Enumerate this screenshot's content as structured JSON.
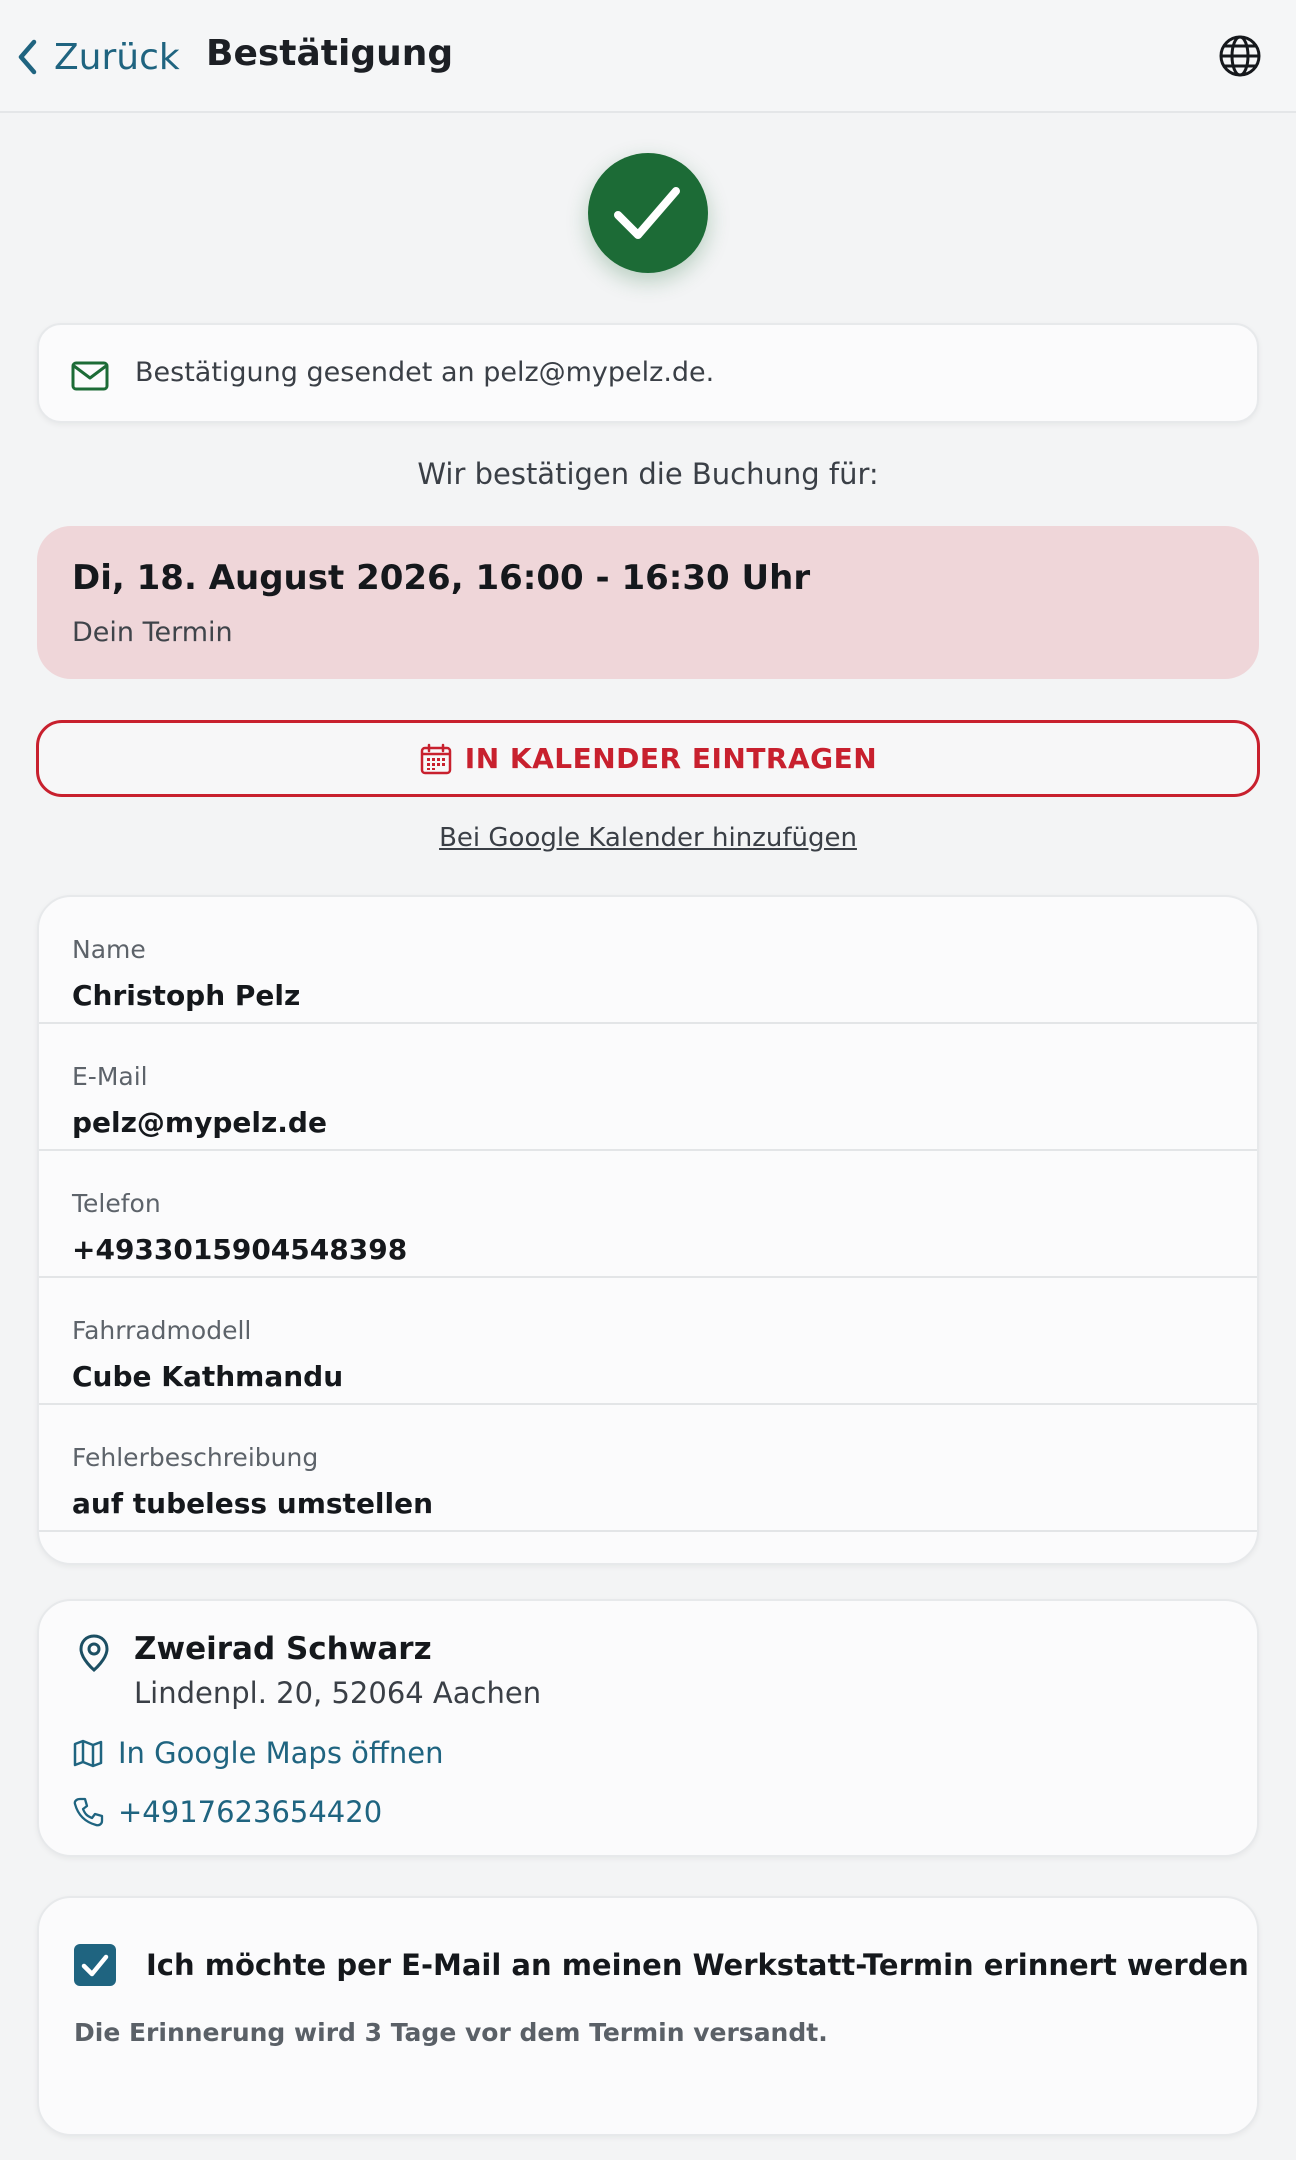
{
  "header": {
    "back_label": "Zurück",
    "title": "Bestätigung",
    "language_icon": "globe-icon"
  },
  "status": {
    "icon": "checkmark-icon",
    "color": "#1c6b36"
  },
  "email_notice": {
    "icon": "mail-icon",
    "text": "Bestätigung gesendet an pelz@mypelz.de."
  },
  "confirm_intro": "Wir bestätigen die Buchung für:",
  "appointment": {
    "time": "Di, 18. August 2026, 16:00 - 16:30 Uhr",
    "subtitle": "Dein Termin",
    "background": "#efd6d9"
  },
  "calendar_button": {
    "icon": "calendar-icon",
    "label": "IN KALENDER EINTRAGEN",
    "accent": "#c8202e"
  },
  "google_calendar_link": "Bei Google Kalender hinzufügen",
  "details": [
    {
      "label": "Name",
      "value": "Christoph Pelz"
    },
    {
      "label": "E-Mail",
      "value": "pelz@mypelz.de"
    },
    {
      "label": "Telefon",
      "value": "+4933015904548398"
    },
    {
      "label": "Fahrradmodell",
      "value": "Cube Kathmandu"
    },
    {
      "label": "Fehlerbeschreibung",
      "value": "auf tubeless umstellen"
    }
  ],
  "location": {
    "name": "Zweirad Schwarz",
    "address": "Lindenpl. 20, 52064 Aachen",
    "maps_link": "In Google Maps öffnen",
    "phone": "+4917623654420",
    "link_color": "#1f6480"
  },
  "reminder": {
    "checked": true,
    "label": "Ich möchte per E-Mail an meinen Werkstatt-Termin erinnert werden",
    "note": "Die Erinnerung wird 3 Tage vor dem Termin versandt."
  }
}
